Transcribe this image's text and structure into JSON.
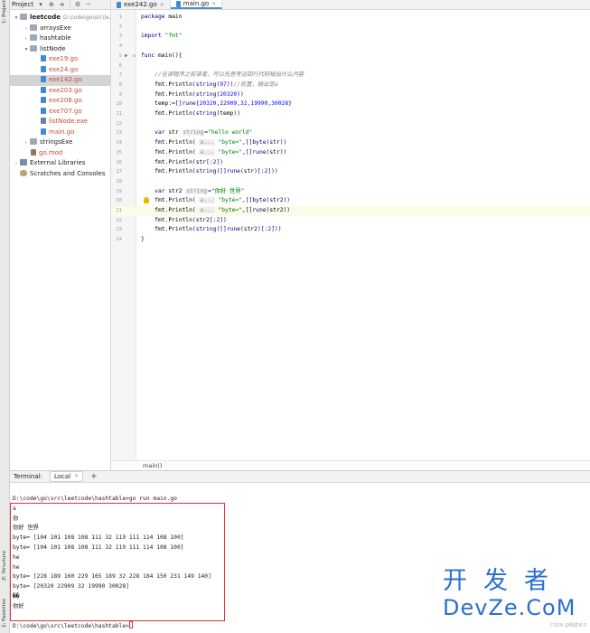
{
  "sidebar": {
    "project_tab": "1: Project",
    "structure_tab": "Z: Structure",
    "favorites_tab": "2: Favorites"
  },
  "project_panel": {
    "title": "Project",
    "icons": [
      "dropdown-icon",
      "target-icon",
      "collapse-icon",
      "settings-icon",
      "minimize-icon"
    ],
    "tree": [
      {
        "label": "leetcode",
        "path": "D:\\code\\go\\src\\le...",
        "depth": 0,
        "arrow": "▾",
        "icon": "folder",
        "bold": true
      },
      {
        "label": "arraysExe",
        "depth": 1,
        "arrow": "›",
        "icon": "folder"
      },
      {
        "label": "hashtable",
        "depth": 1,
        "arrow": "›",
        "icon": "folder"
      },
      {
        "label": "listNode",
        "depth": 1,
        "arrow": "▾",
        "icon": "folder"
      },
      {
        "label": "exe19.go",
        "depth": 2,
        "arrow": "",
        "icon": "gofile",
        "red": true
      },
      {
        "label": "exe24.go",
        "depth": 2,
        "arrow": "",
        "icon": "gofile",
        "red": true
      },
      {
        "label": "exe142.go",
        "depth": 2,
        "arrow": "",
        "icon": "gofile",
        "red": true,
        "selected": true
      },
      {
        "label": "exe203.go",
        "depth": 2,
        "arrow": "",
        "icon": "gofile",
        "red": true
      },
      {
        "label": "exe206.go",
        "depth": 2,
        "arrow": "",
        "icon": "gofile",
        "red": true
      },
      {
        "label": "exe707.go",
        "depth": 2,
        "arrow": "",
        "icon": "gofile",
        "red": true
      },
      {
        "label": "listNode.exe",
        "depth": 2,
        "arrow": "",
        "icon": "exe",
        "red": true
      },
      {
        "label": "main.go",
        "depth": 2,
        "arrow": "",
        "icon": "gofile",
        "red": true
      },
      {
        "label": "stringsExe",
        "depth": 1,
        "arrow": "›",
        "icon": "folder"
      },
      {
        "label": "go.mod",
        "depth": 1,
        "arrow": "",
        "icon": "mod",
        "red": true
      },
      {
        "label": "External Libraries",
        "depth": 0,
        "arrow": "›",
        "icon": "lib"
      },
      {
        "label": "Scratches and Consoles",
        "depth": 0,
        "arrow": "",
        "icon": "scratch"
      }
    ]
  },
  "tabs": [
    {
      "label": "exe242.go",
      "active": false
    },
    {
      "label": "main.go",
      "active": true
    }
  ],
  "editor": {
    "current_line": 21,
    "lines": [
      {
        "n": "1",
        "html": "<span class='kw'>package</span> <span class='id'>main</span>"
      },
      {
        "n": "2",
        "html": ""
      },
      {
        "n": "3",
        "html": "<span class='kw'>import</span> <span class='str'>\"fmt\"</span>"
      },
      {
        "n": "4",
        "html": ""
      },
      {
        "n": "5",
        "html": "<span class='kw'>func</span> <span class='id'>main</span>(){",
        "run": true
      },
      {
        "n": "6",
        "html": ""
      },
      {
        "n": "7",
        "html": "    <span class='cmt'>//在读程序之前读者，可以先思考这四行代码输出什么内容</span>"
      },
      {
        "n": "8",
        "html": "    <span class='id'>fmt</span>.<span class='id'>Println</span>(<span class='kw'>string</span>(<span class='num'>97</span>))<span class='cmt'>//前置，输出是a</span>"
      },
      {
        "n": "9",
        "html": "    <span class='id'>fmt</span>.<span class='id'>Println</span>(<span class='kw'>string</span>(<span class='num'>20320</span>))"
      },
      {
        "n": "10",
        "html": "    <span class='id'>temp</span>:=[]<span class='kw'>rune</span>{<span class='num'>20320</span>,<span class='num'>22909</span>,<span class='num'>32</span>,<span class='num'>19990</span>,<span class='num'>30028</span>}"
      },
      {
        "n": "11",
        "html": "    <span class='id'>fmt</span>.<span class='id'>Println</span>(<span class='kw'>string</span>(<span class='id'>temp</span>))"
      },
      {
        "n": "12",
        "html": ""
      },
      {
        "n": "13",
        "html": "    <span class='kw'>var</span> <span class='id'>str</span> <span class='hint'>string</span>=<span class='str'>\"hello world\"</span>"
      },
      {
        "n": "14",
        "html": "    <span class='id'>fmt</span>.<span class='id'>Println</span>( <span class='hint'>a...</span> <span class='str'>\"byte=\"</span>,[]<span class='kw'>byte</span>(<span class='id'>str</span>))"
      },
      {
        "n": "15",
        "html": "    <span class='id'>fmt</span>.<span class='id'>Println</span>( <span class='hint'>a...</span> <span class='str'>\"byte=\"</span>,[]<span class='kw'>rune</span>(<span class='id'>str</span>))"
      },
      {
        "n": "16",
        "html": "    <span class='id'>fmt</span>.<span class='id'>Println</span>(<span class='id'>str</span>[:<span class='num'>2</span>])"
      },
      {
        "n": "17",
        "html": "    <span class='id'>fmt</span>.<span class='id'>Println</span>(<span class='kw'>string</span>([]<span class='kw'>rune</span>(<span class='id'>str</span>)[:<span class='num'>2</span>]))"
      },
      {
        "n": "18",
        "html": ""
      },
      {
        "n": "19",
        "html": "    <span class='kw'>var</span> <span class='id'>str2</span> <span class='hint'>string</span>=<span class='str'>\"你好 世界\"</span>"
      },
      {
        "n": "20",
        "html": "    <span class='id'>fmt</span>.<span class='id'>Println</span>( <span class='hint'>a...</span> <span class='str'>\"byte=\"</span>,[]<span class='kw'>byte</span>(<span class='id'>str2</span>))",
        "bulb": true
      },
      {
        "n": "21",
        "html": "    <span class='id'>fmt</span>.<span class='id'>Println</span>( <span class='hint'>a...</span> <span class='str'>\"byte=\"</span>,[]<span class='kw'>rune</span>(<span class='id'>str2</span>))"
      },
      {
        "n": "22",
        "html": "    <span class='id'>fmt</span>.<span class='id'>Println</span>(<span class='id'>str2</span>[:<span class='num'>2</span>])"
      },
      {
        "n": "23",
        "html": "    <span class='id'>fmt</span>.<span class='id'>Println</span>(<span class='kw'>string</span>([]<span class='kw'>rune</span>(<span class='id'>str2</span>)[:<span class='num'>2</span>]))"
      },
      {
        "n": "24",
        "html": "}"
      }
    ]
  },
  "breadcrumb": "main()",
  "terminal": {
    "label": "Terminal:",
    "tab": "Local",
    "add": "+",
    "lines": [
      "D:\\code\\go\\src\\leetcode\\hashtable>go run main.go",
      "a",
      "你",
      "你好 世界",
      "byte= [104 101 108 108 111 32 119 111 114 108 100]",
      "byte= [104 101 108 108 111 32 119 111 114 108 100]",
      "he",
      "he",
      "byte= [228 189 160 229 165 189 32 228 184 150 231 149 140]",
      "byte= [20320 22909 32 19990 30028]",
      "��",
      "你好",
      "",
      "D:\\code\\go\\src\\leetcode\\hashtable>"
    ]
  },
  "watermark": {
    "line1": "开发者",
    "line2": "DevZe.CoM",
    "small": "CSDN @明镜米子"
  },
  "colors": {
    "accent": "#4a90d9",
    "highlight_box": "#e0343a",
    "watermark": "#2b6fd0"
  }
}
